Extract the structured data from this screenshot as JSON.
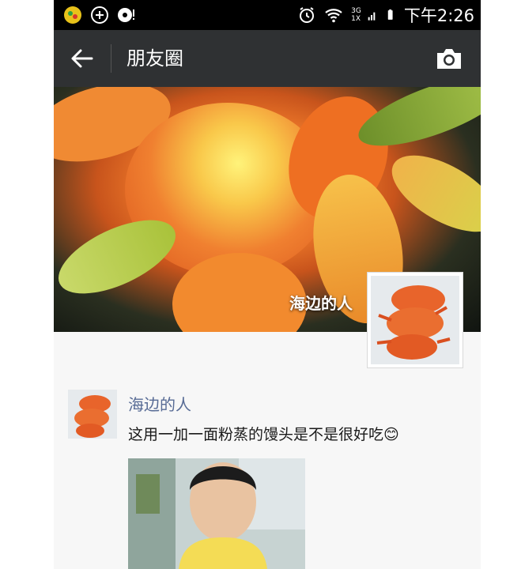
{
  "status_bar": {
    "network": [
      "3G",
      "1X"
    ],
    "time": "下午2:26"
  },
  "header": {
    "title": "朋友圈",
    "icons": [
      "back-arrow-icon",
      "camera-icon"
    ]
  },
  "cover": {
    "name": "海边的人"
  },
  "post": {
    "author": "海边的人",
    "text": "这用一加一面粉蒸的馒头是不是很好吃",
    "emoji": "😊"
  },
  "colors": {
    "header_bg": "#2f3133",
    "name_link": "#576b95",
    "feed_bg": "#f7f7f7"
  }
}
